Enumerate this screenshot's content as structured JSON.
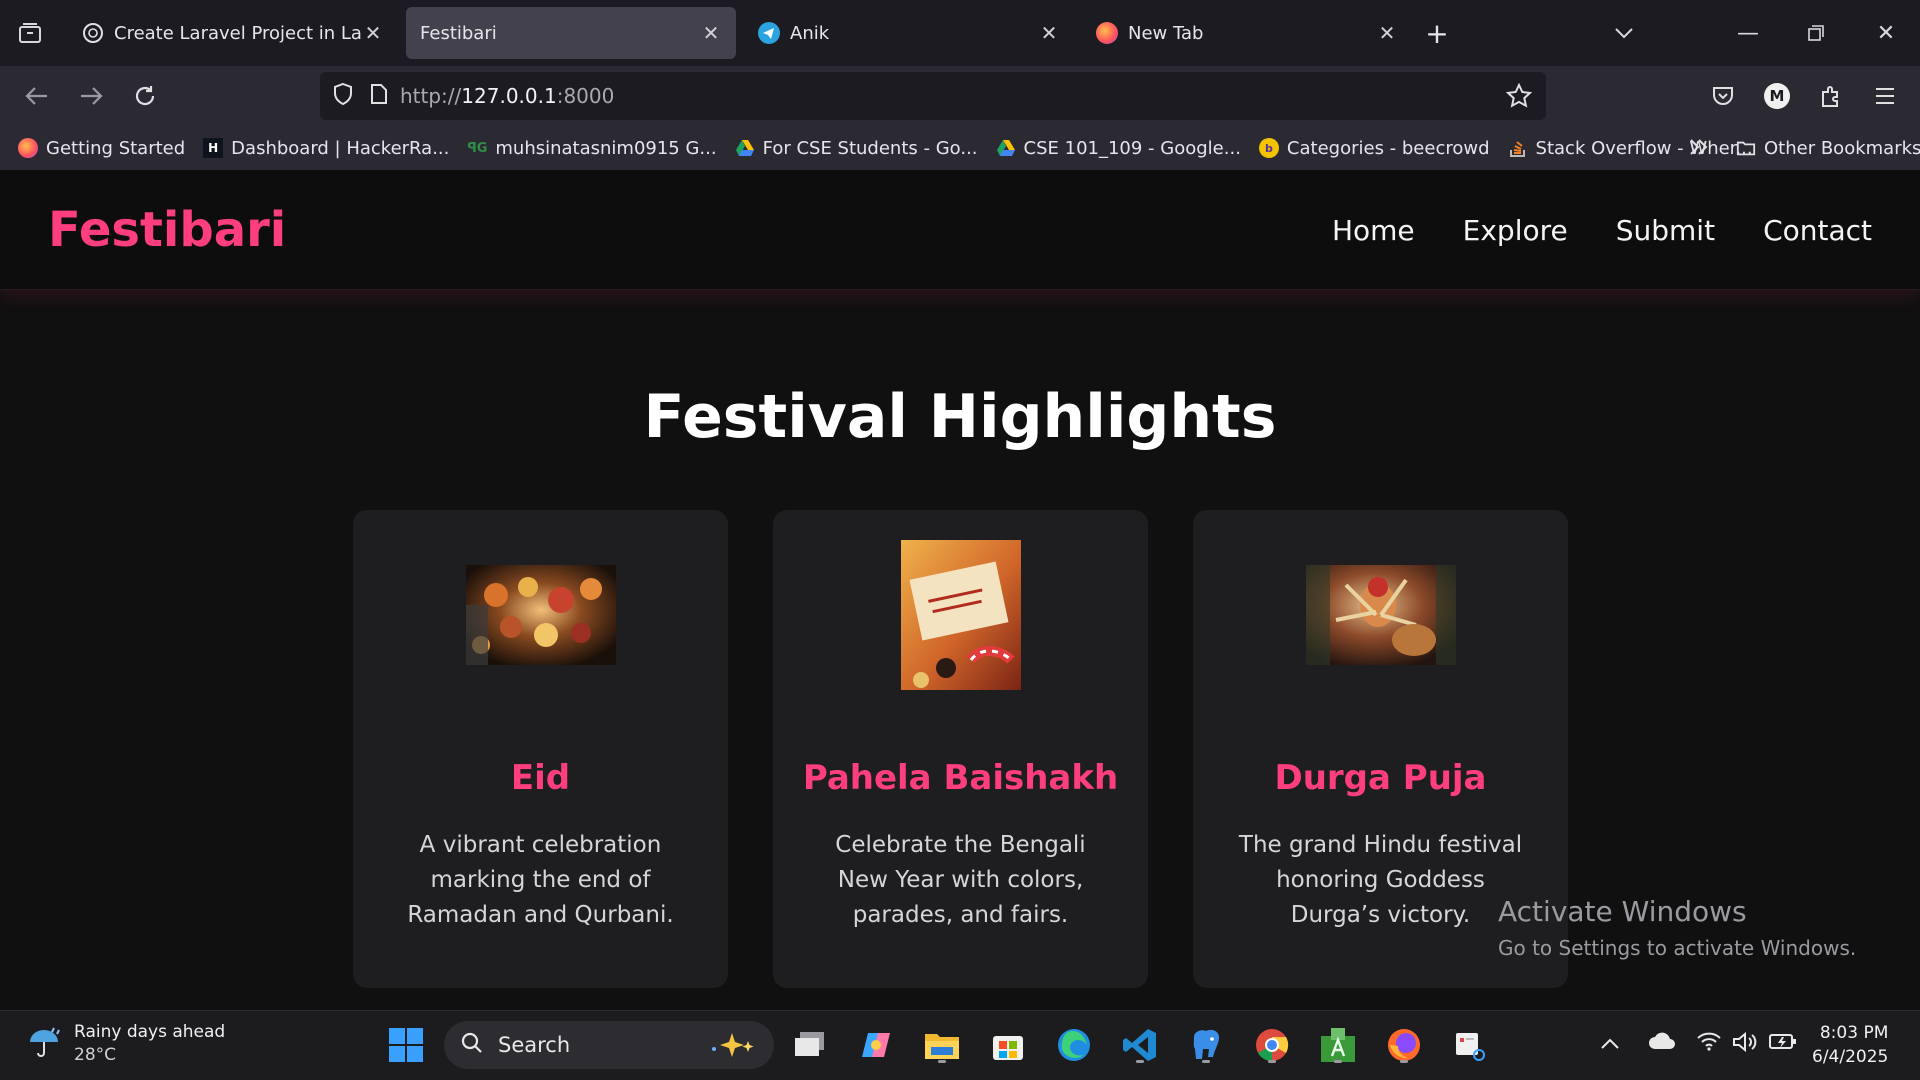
{
  "browser": {
    "tabs": [
      {
        "title": "Create Laravel Project in Larago",
        "icon": "chatgpt-icon",
        "active": false
      },
      {
        "title": "Festibari",
        "icon": "none",
        "active": true
      },
      {
        "title": "Anik",
        "icon": "telegram-icon",
        "active": false
      },
      {
        "title": "New Tab",
        "icon": "firefox-icon",
        "active": false
      }
    ],
    "url_prefix": "http://",
    "url_host": "127.0.0.1",
    "url_suffix": ":8000",
    "bookmarks": [
      {
        "label": "Getting Started",
        "icon": "firefox-icon"
      },
      {
        "label": "Dashboard | HackerRa...",
        "icon": "hackerrank-icon"
      },
      {
        "label": "muhsinatasnim0915 G...",
        "icon": "gfg-icon"
      },
      {
        "label": "For CSE Students - Go...",
        "icon": "google-drive-icon"
      },
      {
        "label": "CSE 101_109 - Google...",
        "icon": "google-drive-icon"
      },
      {
        "label": "Categories - beecrowd",
        "icon": "beecrowd-icon"
      },
      {
        "label": "Stack Overflow - Wher...",
        "icon": "stackoverflow-icon"
      }
    ],
    "other_bookmarks": "Other Bookmarks"
  },
  "site": {
    "logo": "Festibari",
    "nav": [
      "Home",
      "Explore",
      "Submit",
      "Contact"
    ],
    "section_title": "Festival Highlights",
    "cards": [
      {
        "name": "Eid",
        "description": "A vibrant celebration marking the end of Ramadan and Qurbani.",
        "image": "lanterns-photo"
      },
      {
        "name": "Pahela Baishakh",
        "description": "Celebrate the Bengali New Year with colors, parades, and fairs.",
        "image": "new-year-card-photo"
      },
      {
        "name": "Durga Puja",
        "description": "The grand Hindu festival honoring Goddess Durga’s victory.",
        "image": "durga-idol-photo"
      }
    ],
    "brand_color": "#ff3e7f"
  },
  "watermark": {
    "line1": "Activate Windows",
    "line2": "Go to Settings to activate Windows."
  },
  "taskbar": {
    "weather_title": "Rainy days ahead",
    "weather_temp": "28°C",
    "search_placeholder": "Search",
    "time": "8:03 PM",
    "date": "6/4/2025"
  }
}
